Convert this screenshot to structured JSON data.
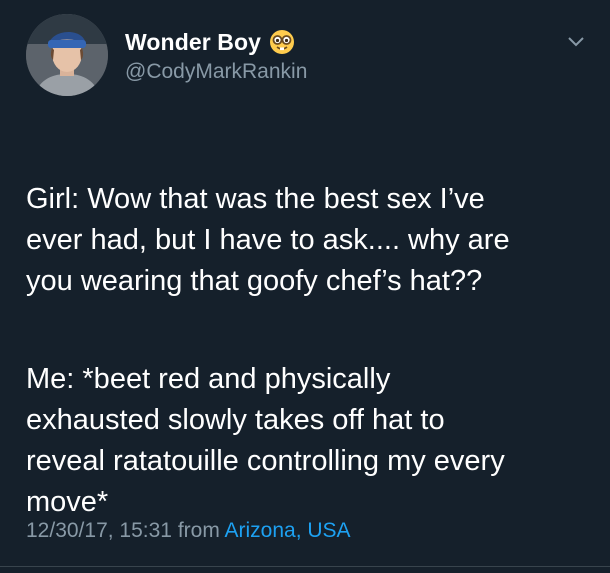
{
  "tweet": {
    "display_name": "Wonder Boy",
    "name_emoji": "nerd-face-emoji",
    "handle": "@CodyMarkRankin",
    "paragraph1": "Girl: Wow that was the best sex I’ve\never had, but I have to ask.... why are\nyou wearing that goofy chef’s hat??",
    "paragraph2": "Me: *beet red and physically\nexhausted slowly takes off hat to\nreveal ratatouille controlling my every\nmove*",
    "timestamp": "12/30/17, 15:31",
    "from_word": "from",
    "location": "Arizona, USA"
  },
  "colors": {
    "background": "#15202b",
    "text": "#ffffff",
    "secondary_text": "#8899a6",
    "link": "#1da1f2"
  },
  "icons": {
    "menu": "chevron-down-icon",
    "avatar": "profile-avatar"
  }
}
